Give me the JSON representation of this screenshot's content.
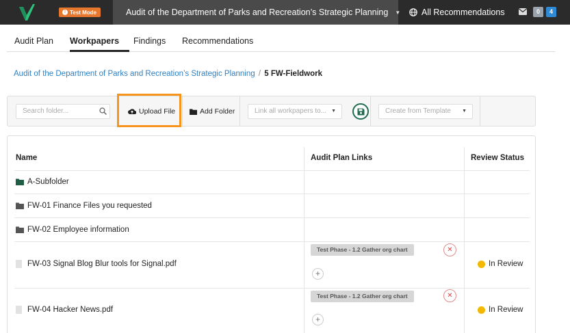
{
  "topbar": {
    "test_mode_label": "Test Mode",
    "project_title": "Audit of the Department of Parks and Recreation’s Strategic Planning",
    "all_recommendations": "All Recommendations",
    "counts": [
      "0",
      "4"
    ]
  },
  "tabs": [
    {
      "label": "Audit Plan",
      "active": false
    },
    {
      "label": "Workpapers",
      "active": true
    },
    {
      "label": "Findings",
      "active": false
    },
    {
      "label": "Recommendations",
      "active": false
    }
  ],
  "breadcrumb": {
    "parent": "Audit of the Department of Parks and Recreation’s Strategic Planning",
    "separator": "/",
    "current": "5 FW-Fieldwork"
  },
  "toolbar": {
    "search_placeholder": "Search folder...",
    "upload_label": "Upload File",
    "add_folder_label": "Add Folder",
    "link_placeholder": "Link all workpapers to...",
    "template_placeholder": "Create from Template"
  },
  "table": {
    "headers": {
      "name": "Name",
      "links": "Audit Plan Links",
      "status": "Review Status"
    },
    "rows": [
      {
        "type": "folder",
        "name": "A-Subfolder",
        "icon_color": "#1f5e45"
      },
      {
        "type": "folder",
        "name": "FW-01 Finance Files you requested",
        "icon_color": "#555555"
      },
      {
        "type": "folder",
        "name": "FW-02 Employee information",
        "icon_color": "#555555"
      },
      {
        "type": "file",
        "name": "FW-03 Signal Blog Blur tools for Signal.pdf",
        "link": "Test Phase - 1.2 Gather org chart",
        "status": "In Review"
      },
      {
        "type": "file",
        "name": "FW-04 Hacker News.pdf",
        "link": "Test Phase - 1.2 Gather org chart",
        "status": "In Review"
      }
    ]
  },
  "colors": {
    "accent_orange": "#f7941d",
    "brand_green": "#1f6b4e",
    "link_blue": "#2f7fc1",
    "status_yellow": "#f5b800"
  }
}
